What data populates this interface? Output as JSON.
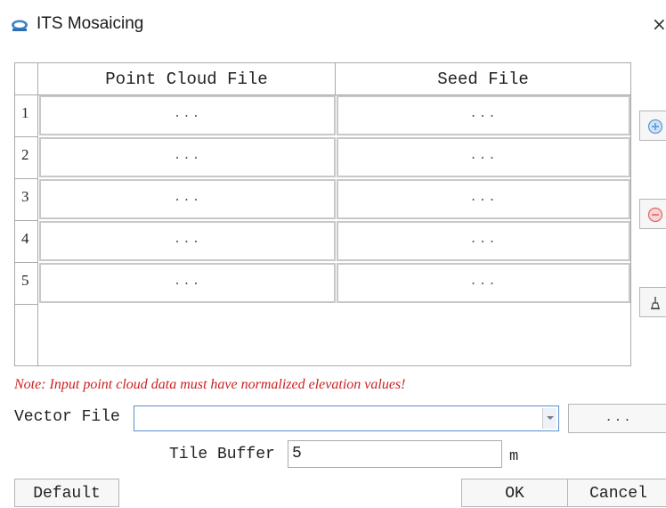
{
  "window": {
    "title": "ITS Mosaicing",
    "logo_icon": "app-logo-icon",
    "close_label": "×"
  },
  "table": {
    "columns": [
      "Point Cloud File",
      "Seed File"
    ],
    "rows": [
      {
        "index": "1",
        "point_cloud": "...",
        "seed": "..."
      },
      {
        "index": "2",
        "point_cloud": "...",
        "seed": "..."
      },
      {
        "index": "3",
        "point_cloud": "...",
        "seed": "..."
      },
      {
        "index": "4",
        "point_cloud": "...",
        "seed": "..."
      },
      {
        "index": "5",
        "point_cloud": "...",
        "seed": "..."
      }
    ]
  },
  "side_buttons": {
    "add_icon": "plus-circle-icon",
    "remove_icon": "minus-circle-icon",
    "clear_icon": "broom-icon"
  },
  "note": "Note: Input point cloud data must have normalized elevation values!",
  "vector_file": {
    "label": "Vector File",
    "value": "",
    "browse_label": "..."
  },
  "tile_buffer": {
    "label": "Tile Buffer",
    "value": "5",
    "unit": "m"
  },
  "buttons": {
    "default": "Default",
    "ok": "OK",
    "cancel": "Cancel"
  },
  "colors": {
    "note_red": "#cc1f1f",
    "focus_blue": "#5a8fd0",
    "icon_blue": "#5b9bd5",
    "icon_red": "#e06666"
  }
}
